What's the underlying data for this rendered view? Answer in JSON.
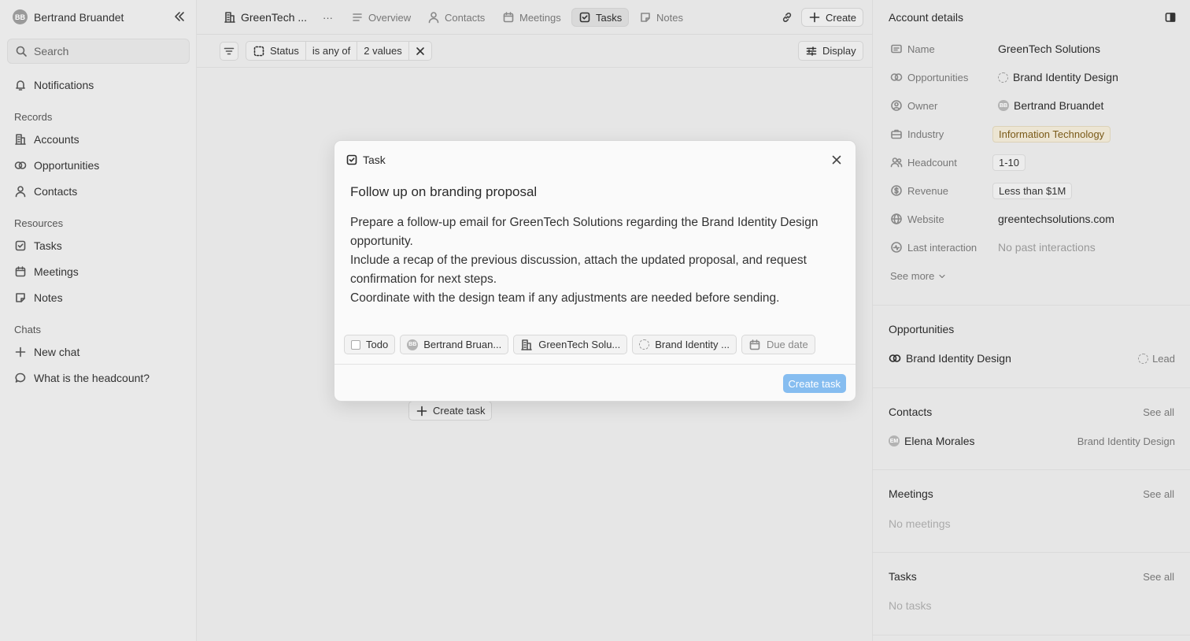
{
  "sidebar": {
    "user": {
      "initials": "BB",
      "name": "Bertrand Bruandet"
    },
    "search_label": "Search",
    "notifications": "Notifications",
    "sections": {
      "records": "Records",
      "resources": "Resources",
      "chats": "Chats"
    },
    "records": [
      "Accounts",
      "Opportunities",
      "Contacts"
    ],
    "resources": [
      "Tasks",
      "Meetings",
      "Notes"
    ],
    "chats": [
      "New chat",
      "What is the headcount?"
    ]
  },
  "topbar": {
    "record_name": "GreenTech ...",
    "more": "···",
    "tabs": [
      "Overview",
      "Contacts",
      "Meetings",
      "Tasks",
      "Notes"
    ],
    "active_tab": "Tasks",
    "create_label": "Create"
  },
  "filter": {
    "field": "Status",
    "operator": "is any of",
    "value": "2 values",
    "display_label": "Display"
  },
  "background": {
    "create_task": "Create task"
  },
  "modal": {
    "header": "Task",
    "title": "Follow up on branding proposal",
    "description": [
      "Prepare a follow-up email for GreenTech Solutions regarding the Brand Identity Design opportunity.",
      "Include a recap of the previous discussion, attach the updated proposal, and request confirmation for next steps.",
      "Coordinate with the design team if any adjustments are needed before sending."
    ],
    "chips": {
      "status": "Todo",
      "assignee_initials": "BB",
      "assignee": "Bertrand Bruan...",
      "account": "GreenTech Solu...",
      "opportunity": "Brand Identity ...",
      "due_date": "Due date"
    },
    "submit": "Create task",
    "submit_color": "#86bdf0"
  },
  "right_panel": {
    "title": "Account details",
    "fields": [
      {
        "label": "Name",
        "value": "GreenTech Solutions"
      },
      {
        "label": "Opportunities",
        "value": "Brand Identity Design"
      },
      {
        "label": "Owner",
        "value": "Bertrand Bruandet",
        "initials": "BB"
      },
      {
        "label": "Industry",
        "value": "Information Technology"
      },
      {
        "label": "Headcount",
        "value": "1-10"
      },
      {
        "label": "Revenue",
        "value": "Less than $1M"
      },
      {
        "label": "Website",
        "value": "greentechsolutions.com"
      },
      {
        "label": "Last interaction",
        "value": "No past interactions"
      }
    ],
    "see_more": "See more",
    "opportunities": {
      "title": "Opportunities",
      "items": [
        {
          "name": "Brand Identity Design",
          "stage": "Lead"
        }
      ]
    },
    "contacts": {
      "title": "Contacts",
      "see_all": "See all",
      "items": [
        {
          "initials": "EM",
          "name": "Elena Morales",
          "related": "Brand Identity Design"
        }
      ]
    },
    "meetings": {
      "title": "Meetings",
      "see_all": "See all",
      "empty": "No meetings"
    },
    "tasks": {
      "title": "Tasks",
      "see_all": "See all",
      "empty": "No tasks"
    },
    "industry_tag_color": "#ece5d3"
  }
}
